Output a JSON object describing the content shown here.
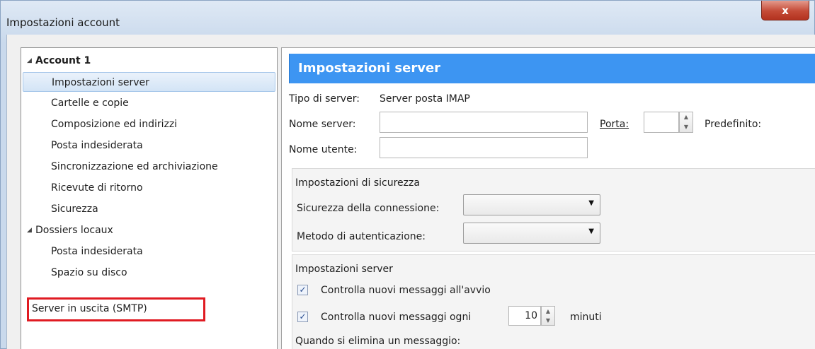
{
  "window": {
    "title": "Impostazioni account",
    "close_glyph": "x"
  },
  "tree": {
    "account1": "Account 1",
    "account1_items": [
      "Impostazioni server",
      "Cartelle e copie",
      "Composizione ed indirizzi",
      "Posta indesiderata",
      "Sincronizzazione ed archiviazione",
      "Ricevute di ritorno",
      "Sicurezza"
    ],
    "local": "Dossiers locaux",
    "local_items": [
      "Posta indesiderata",
      "Spazio su disco"
    ],
    "smtp": "Server in uscita (SMTP)"
  },
  "panel": {
    "banner": "Impostazioni server",
    "server_type_label": "Tipo di server:",
    "server_type_value": "Server posta IMAP",
    "server_name_label": "Nome server:",
    "server_name_value": "",
    "port_label": "Porta:",
    "port_value": "",
    "default_label": "Predefinito:",
    "username_label": "Nome utente:",
    "username_value": "",
    "security_section": "Impostazioni di sicurezza",
    "conn_security_label": "Sicurezza della connessione:",
    "conn_security_value": "",
    "auth_method_label": "Metodo di autenticazione:",
    "auth_method_value": "",
    "server_section": "Impostazioni server",
    "check_startup_label": "Controlla nuovi messaggi all'avvio",
    "check_startup_checked": true,
    "check_every_label": "Controlla nuovi messaggi ogni",
    "check_every_checked": true,
    "check_every_value": "10",
    "minutes_label": "minuti",
    "on_delete_label": "Quando si elimina un messaggio:"
  }
}
